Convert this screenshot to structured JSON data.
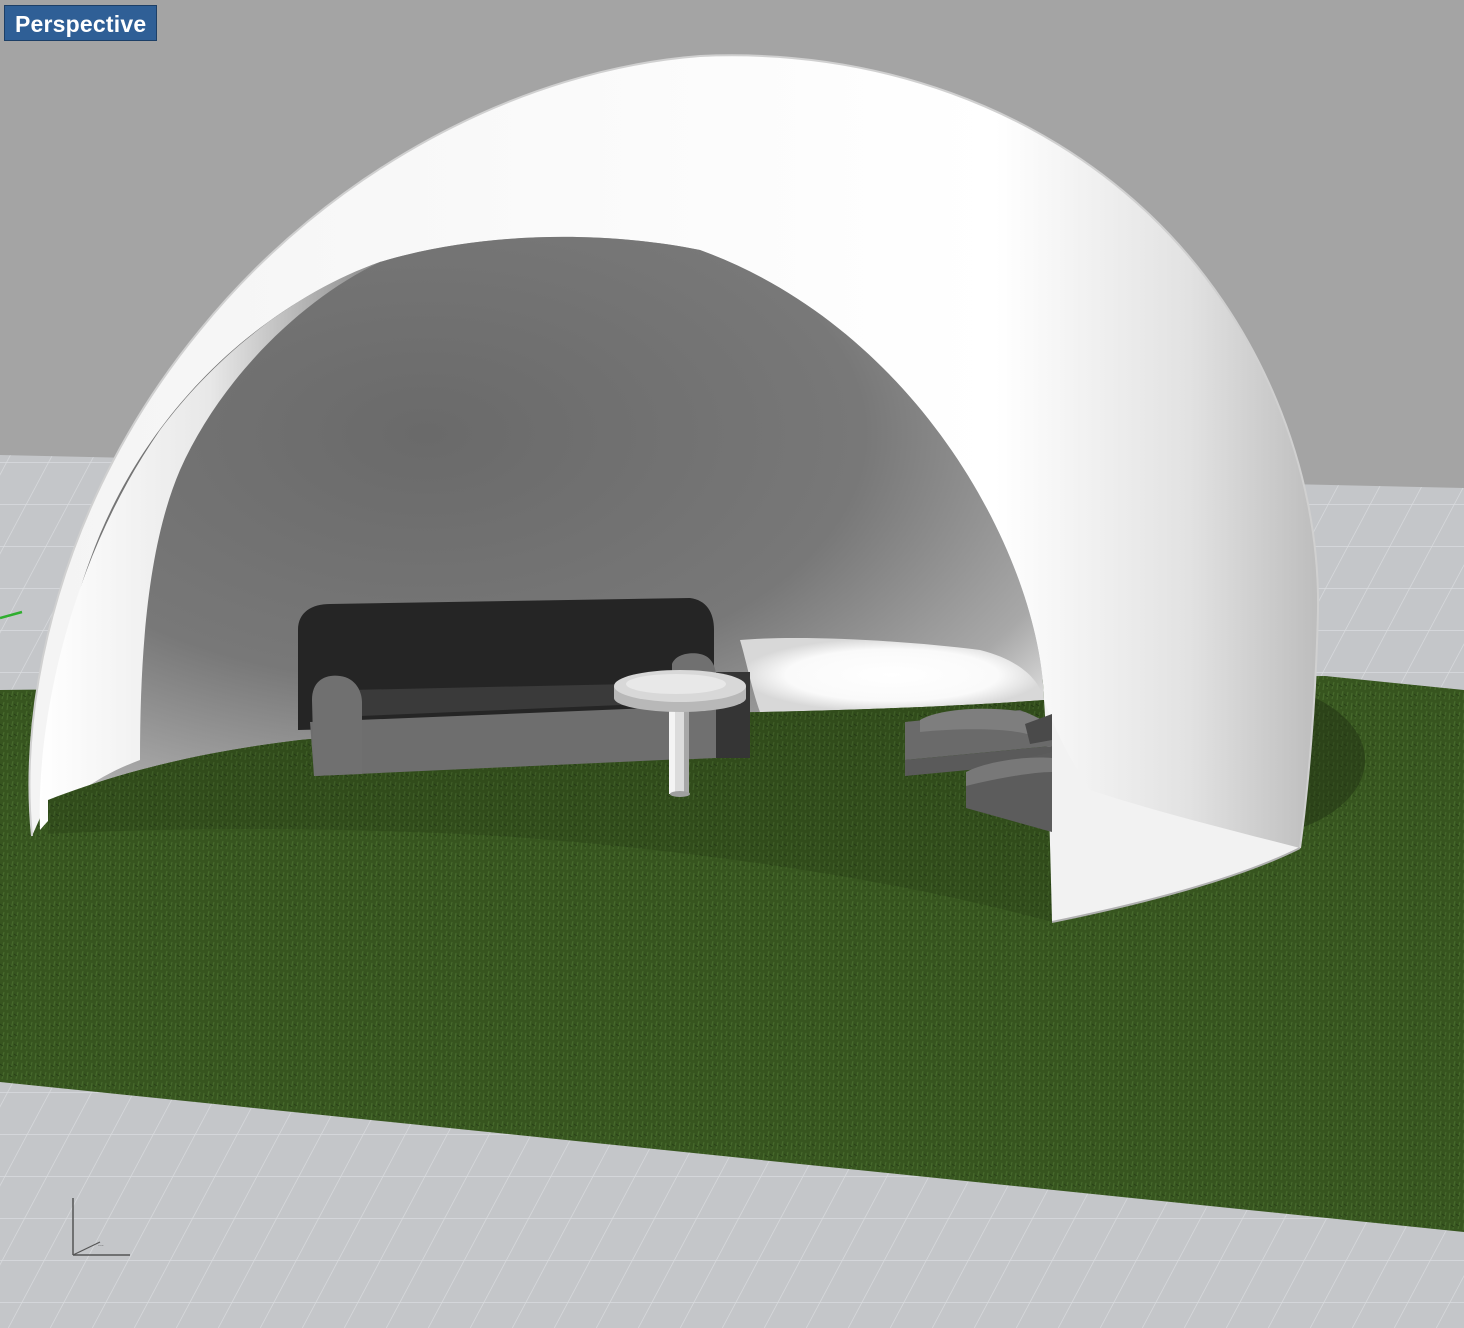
{
  "viewport": {
    "label": "Perspective",
    "axis_icon": "world-axes-icon"
  },
  "colors": {
    "tab_background": "#2f5f96",
    "background": "#a4a4a4",
    "grid_plane": "#c4c6c9",
    "grid_lines": "#d6d8db",
    "grass": "#3d5e22",
    "dome": "#ffffff",
    "dome_interior": "#707070",
    "sofa": "#6e6e6e",
    "y_axis": "#2fae2f"
  },
  "scene_objects": [
    "dome",
    "sofa",
    "round-table",
    "lounge-chair",
    "grass-ground",
    "construction-grid"
  ]
}
